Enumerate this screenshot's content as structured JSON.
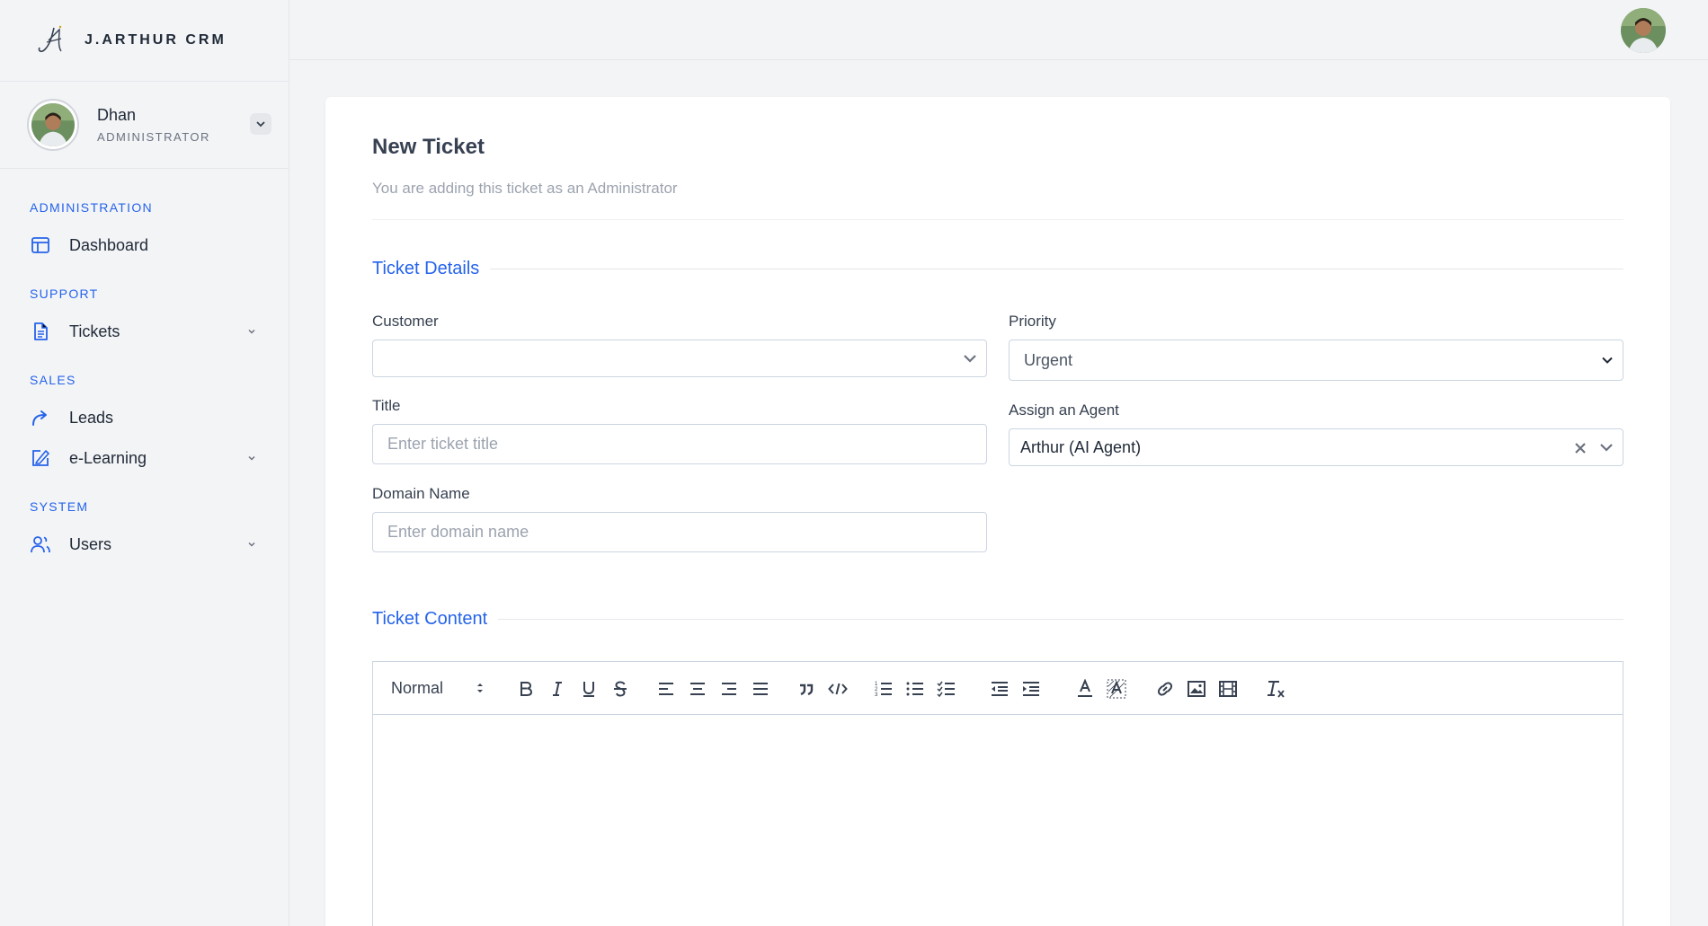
{
  "brand": {
    "name": "J.ARTHUR CRM",
    "logo_text": "JA"
  },
  "profile": {
    "name": "Dhan",
    "role": "ADMINISTRATOR"
  },
  "nav": {
    "administration": "ADMINISTRATION",
    "dashboard": "Dashboard",
    "support": "SUPPORT",
    "tickets": "Tickets",
    "sales": "SALES",
    "leads": "Leads",
    "elearning": "e-Learning",
    "system": "SYSTEM",
    "users": "Users"
  },
  "page": {
    "title": "New Ticket",
    "subtitle": "You are adding this ticket as an Administrator"
  },
  "details": {
    "heading": "Ticket Details",
    "customer_label": "Customer",
    "customer_value": "",
    "priority_label": "Priority",
    "priority_value": "Urgent",
    "title_label": "Title",
    "title_placeholder": "Enter ticket title",
    "agent_label": "Assign an Agent",
    "agent_value": "Arthur (AI Agent)",
    "domain_label": "Domain Name",
    "domain_placeholder": "Enter domain name"
  },
  "content": {
    "heading": "Ticket Content",
    "format_value": "Normal"
  },
  "colors": {
    "accent": "#2563eb",
    "text": "#374151",
    "border": "#cbd5e1"
  },
  "icons": [
    "chevron-down-icon",
    "dashboard-icon",
    "document-icon",
    "share-arrow-icon",
    "pen-square-icon",
    "users-icon",
    "close-icon",
    "bold-icon",
    "italic-icon",
    "underline-icon",
    "strike-icon",
    "align-left-icon",
    "align-center-icon",
    "align-right-icon",
    "align-justify-icon",
    "blockquote-icon",
    "code-icon",
    "ordered-list-icon",
    "bullet-list-icon",
    "check-list-icon",
    "outdent-icon",
    "indent-icon",
    "text-color-icon",
    "background-color-icon",
    "link-icon",
    "image-icon",
    "video-icon",
    "clear-format-icon"
  ]
}
